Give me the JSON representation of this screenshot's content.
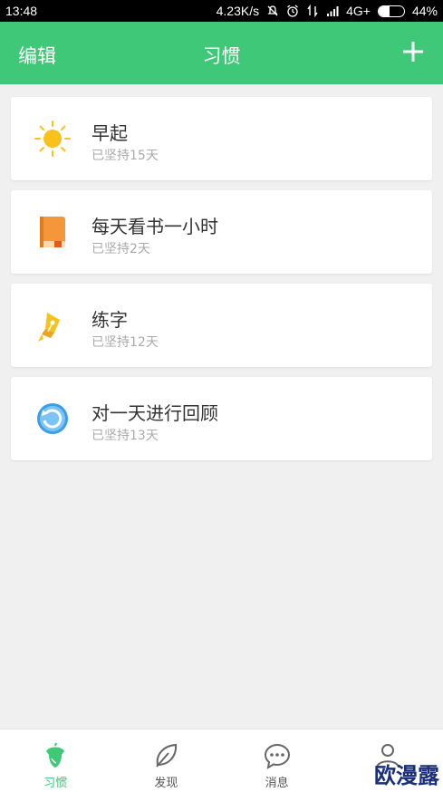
{
  "status_bar": {
    "time": "13:48",
    "network_speed": "4.23K/s",
    "network_type": "4G+",
    "battery_percent": "44%",
    "battery_level": 0.44
  },
  "header": {
    "edit_label": "编辑",
    "title": "习惯",
    "add_icon": "plus-icon"
  },
  "habits": [
    {
      "name": "早起",
      "days": "已坚持15天",
      "icon": "sun-icon"
    },
    {
      "name": "每天看书一小时",
      "days": "已坚持2天",
      "icon": "book-icon"
    },
    {
      "name": "练字",
      "days": "已坚持12天",
      "icon": "pen-icon"
    },
    {
      "name": "对一天进行回顾",
      "days": "已坚持13天",
      "icon": "refresh-icon"
    }
  ],
  "tabs": [
    {
      "label": "习惯",
      "icon": "acorn-icon",
      "active": true
    },
    {
      "label": "发现",
      "icon": "leaf-icon",
      "active": false
    },
    {
      "label": "消息",
      "icon": "chat-icon",
      "active": false
    },
    {
      "label": "",
      "icon": "user-icon",
      "active": false
    }
  ],
  "watermark": "欧漫露",
  "colors": {
    "brand_green": "#3ec877",
    "background": "#f0f0f0",
    "sun": "#f7c21c",
    "book": "#f5963a",
    "refresh": "#3a9ee8"
  }
}
